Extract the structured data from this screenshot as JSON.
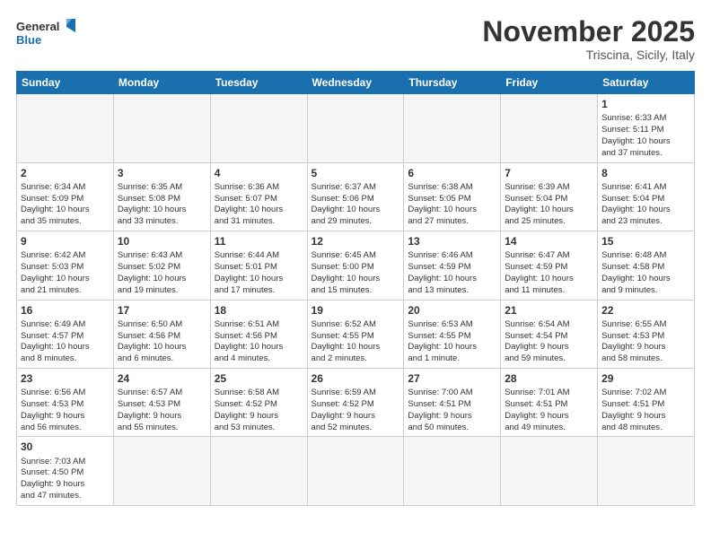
{
  "logo": {
    "text_general": "General",
    "text_blue": "Blue"
  },
  "title": "November 2025",
  "subtitle": "Triscina, Sicily, Italy",
  "weekdays": [
    "Sunday",
    "Monday",
    "Tuesday",
    "Wednesday",
    "Thursday",
    "Friday",
    "Saturday"
  ],
  "weeks": [
    [
      {
        "day": "",
        "info": ""
      },
      {
        "day": "",
        "info": ""
      },
      {
        "day": "",
        "info": ""
      },
      {
        "day": "",
        "info": ""
      },
      {
        "day": "",
        "info": ""
      },
      {
        "day": "",
        "info": ""
      },
      {
        "day": "1",
        "info": "Sunrise: 6:33 AM\nSunset: 5:11 PM\nDaylight: 10 hours\nand 37 minutes."
      }
    ],
    [
      {
        "day": "2",
        "info": "Sunrise: 6:34 AM\nSunset: 5:09 PM\nDaylight: 10 hours\nand 35 minutes."
      },
      {
        "day": "3",
        "info": "Sunrise: 6:35 AM\nSunset: 5:08 PM\nDaylight: 10 hours\nand 33 minutes."
      },
      {
        "day": "4",
        "info": "Sunrise: 6:36 AM\nSunset: 5:07 PM\nDaylight: 10 hours\nand 31 minutes."
      },
      {
        "day": "5",
        "info": "Sunrise: 6:37 AM\nSunset: 5:06 PM\nDaylight: 10 hours\nand 29 minutes."
      },
      {
        "day": "6",
        "info": "Sunrise: 6:38 AM\nSunset: 5:05 PM\nDaylight: 10 hours\nand 27 minutes."
      },
      {
        "day": "7",
        "info": "Sunrise: 6:39 AM\nSunset: 5:04 PM\nDaylight: 10 hours\nand 25 minutes."
      },
      {
        "day": "8",
        "info": "Sunrise: 6:41 AM\nSunset: 5:04 PM\nDaylight: 10 hours\nand 23 minutes."
      }
    ],
    [
      {
        "day": "9",
        "info": "Sunrise: 6:42 AM\nSunset: 5:03 PM\nDaylight: 10 hours\nand 21 minutes."
      },
      {
        "day": "10",
        "info": "Sunrise: 6:43 AM\nSunset: 5:02 PM\nDaylight: 10 hours\nand 19 minutes."
      },
      {
        "day": "11",
        "info": "Sunrise: 6:44 AM\nSunset: 5:01 PM\nDaylight: 10 hours\nand 17 minutes."
      },
      {
        "day": "12",
        "info": "Sunrise: 6:45 AM\nSunset: 5:00 PM\nDaylight: 10 hours\nand 15 minutes."
      },
      {
        "day": "13",
        "info": "Sunrise: 6:46 AM\nSunset: 4:59 PM\nDaylight: 10 hours\nand 13 minutes."
      },
      {
        "day": "14",
        "info": "Sunrise: 6:47 AM\nSunset: 4:59 PM\nDaylight: 10 hours\nand 11 minutes."
      },
      {
        "day": "15",
        "info": "Sunrise: 6:48 AM\nSunset: 4:58 PM\nDaylight: 10 hours\nand 9 minutes."
      }
    ],
    [
      {
        "day": "16",
        "info": "Sunrise: 6:49 AM\nSunset: 4:57 PM\nDaylight: 10 hours\nand 8 minutes."
      },
      {
        "day": "17",
        "info": "Sunrise: 6:50 AM\nSunset: 4:56 PM\nDaylight: 10 hours\nand 6 minutes."
      },
      {
        "day": "18",
        "info": "Sunrise: 6:51 AM\nSunset: 4:56 PM\nDaylight: 10 hours\nand 4 minutes."
      },
      {
        "day": "19",
        "info": "Sunrise: 6:52 AM\nSunset: 4:55 PM\nDaylight: 10 hours\nand 2 minutes."
      },
      {
        "day": "20",
        "info": "Sunrise: 6:53 AM\nSunset: 4:55 PM\nDaylight: 10 hours\nand 1 minute."
      },
      {
        "day": "21",
        "info": "Sunrise: 6:54 AM\nSunset: 4:54 PM\nDaylight: 9 hours\nand 59 minutes."
      },
      {
        "day": "22",
        "info": "Sunrise: 6:55 AM\nSunset: 4:53 PM\nDaylight: 9 hours\nand 58 minutes."
      }
    ],
    [
      {
        "day": "23",
        "info": "Sunrise: 6:56 AM\nSunset: 4:53 PM\nDaylight: 9 hours\nand 56 minutes."
      },
      {
        "day": "24",
        "info": "Sunrise: 6:57 AM\nSunset: 4:53 PM\nDaylight: 9 hours\nand 55 minutes."
      },
      {
        "day": "25",
        "info": "Sunrise: 6:58 AM\nSunset: 4:52 PM\nDaylight: 9 hours\nand 53 minutes."
      },
      {
        "day": "26",
        "info": "Sunrise: 6:59 AM\nSunset: 4:52 PM\nDaylight: 9 hours\nand 52 minutes."
      },
      {
        "day": "27",
        "info": "Sunrise: 7:00 AM\nSunset: 4:51 PM\nDaylight: 9 hours\nand 50 minutes."
      },
      {
        "day": "28",
        "info": "Sunrise: 7:01 AM\nSunset: 4:51 PM\nDaylight: 9 hours\nand 49 minutes."
      },
      {
        "day": "29",
        "info": "Sunrise: 7:02 AM\nSunset: 4:51 PM\nDaylight: 9 hours\nand 48 minutes."
      }
    ],
    [
      {
        "day": "30",
        "info": "Sunrise: 7:03 AM\nSunset: 4:50 PM\nDaylight: 9 hours\nand 47 minutes."
      },
      {
        "day": "",
        "info": ""
      },
      {
        "day": "",
        "info": ""
      },
      {
        "day": "",
        "info": ""
      },
      {
        "day": "",
        "info": ""
      },
      {
        "day": "",
        "info": ""
      },
      {
        "day": "",
        "info": ""
      }
    ]
  ]
}
